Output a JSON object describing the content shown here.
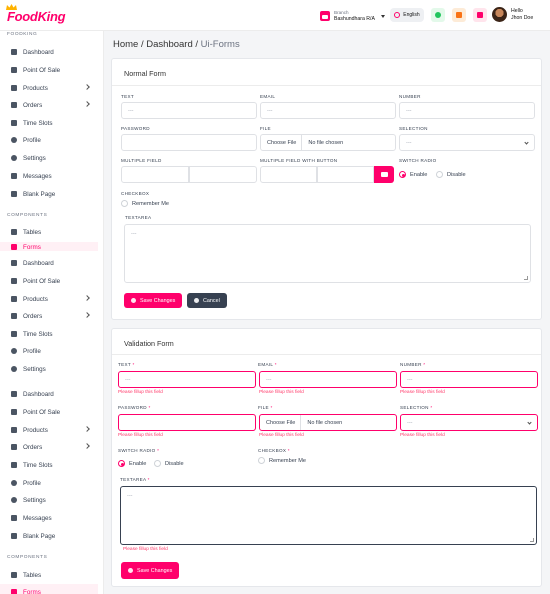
{
  "brand": {
    "name": "FoodKing"
  },
  "header": {
    "branch_label": "Branch",
    "branch_name": "Bashundhara R/A",
    "language": "English",
    "greeting": "Hello",
    "user_name": "Jhon Doe"
  },
  "sidebar": {
    "section_foodking": "FOODKING",
    "section_components": "COMPONENTS",
    "menu": [
      "Dashboard",
      "Point Of Sale",
      "Products",
      "Orders",
      "Time Slots",
      "Profile",
      "Settings",
      "Messages",
      "Blank Page"
    ],
    "menu_short": [
      "Dashboard",
      "Point Of Sale",
      "Products",
      "Orders",
      "Time Slots",
      "Profile",
      "Settings"
    ],
    "components": [
      "Tables",
      "Forms"
    ]
  },
  "breadcrumb": {
    "home": "Home",
    "sep": "/",
    "dashboard": "Dashboard",
    "current": "Ui-Forms"
  },
  "normal_form": {
    "title": "Normal Form",
    "text_label": "TEXT",
    "email_label": "EMAIL",
    "number_label": "NUMBER",
    "password_label": "PASSWORD",
    "file_label": "FILE",
    "selection_label": "SELECTION",
    "multiple_label": "MULTIPLE FIELD",
    "multiple_btn_label": "MULTIPLE FIELD WITH BUTTON",
    "switch_label": "SWITCH RADIO",
    "checkbox_label": "CHECKBOX",
    "textarea_label": "TEXTAREA",
    "placeholder": "---",
    "choose_file": "Choose File",
    "no_file": "No file chosen",
    "enable": "Enable",
    "disable": "Disable",
    "remember": "Remember Me",
    "save": "Save Changes",
    "cancel": "Cancel"
  },
  "validation_form": {
    "title": "Validation Form",
    "text_label": "TEXT",
    "email_label": "EMAIL",
    "number_label": "NUMBER",
    "password_label": "PASSWORD",
    "file_label": "FILE",
    "selection_label": "SELECTION",
    "switch_label": "SWITCH RADIO",
    "checkbox_label": "CHECKBOX",
    "textarea_label": "TEXTAREA",
    "required_mark": "*",
    "placeholder": "---",
    "choose_file": "Choose File",
    "no_file": "No file chosen",
    "enable": "Enable",
    "disable": "Disable",
    "remember": "Remember Me",
    "error": "Please fillup this field",
    "save": "Save Changes"
  },
  "colors": {
    "accent": "#ff006b",
    "dark_button": "#374151"
  }
}
